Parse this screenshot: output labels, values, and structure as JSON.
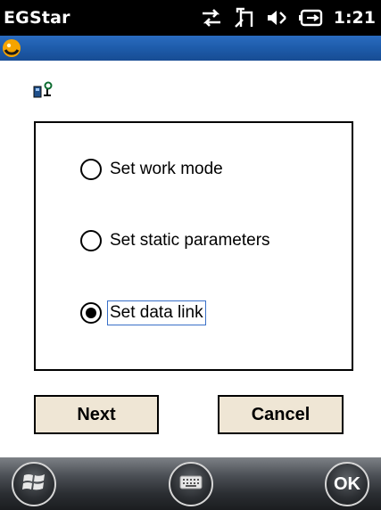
{
  "status_bar": {
    "app_title": "EGStar",
    "time": "1:21",
    "icons": [
      "sync-arrows-icon",
      "connectivity-icon",
      "speaker-icon",
      "battery-icon"
    ]
  },
  "caption_bar": {
    "icon": "app-logo-icon",
    "accent_color": "#1d5aa8"
  },
  "page": {
    "header_icon": "network-device-icon"
  },
  "options": {
    "items": [
      {
        "label": "Set work mode",
        "selected": false
      },
      {
        "label": "Set static parameters",
        "selected": false
      },
      {
        "label": "Set data link",
        "selected": true
      }
    ]
  },
  "buttons": {
    "next_label": "Next",
    "cancel_label": "Cancel"
  },
  "taskbar": {
    "start_icon": "windows-logo-icon",
    "keyboard_icon": "keyboard-icon",
    "ok_label": "OK"
  }
}
